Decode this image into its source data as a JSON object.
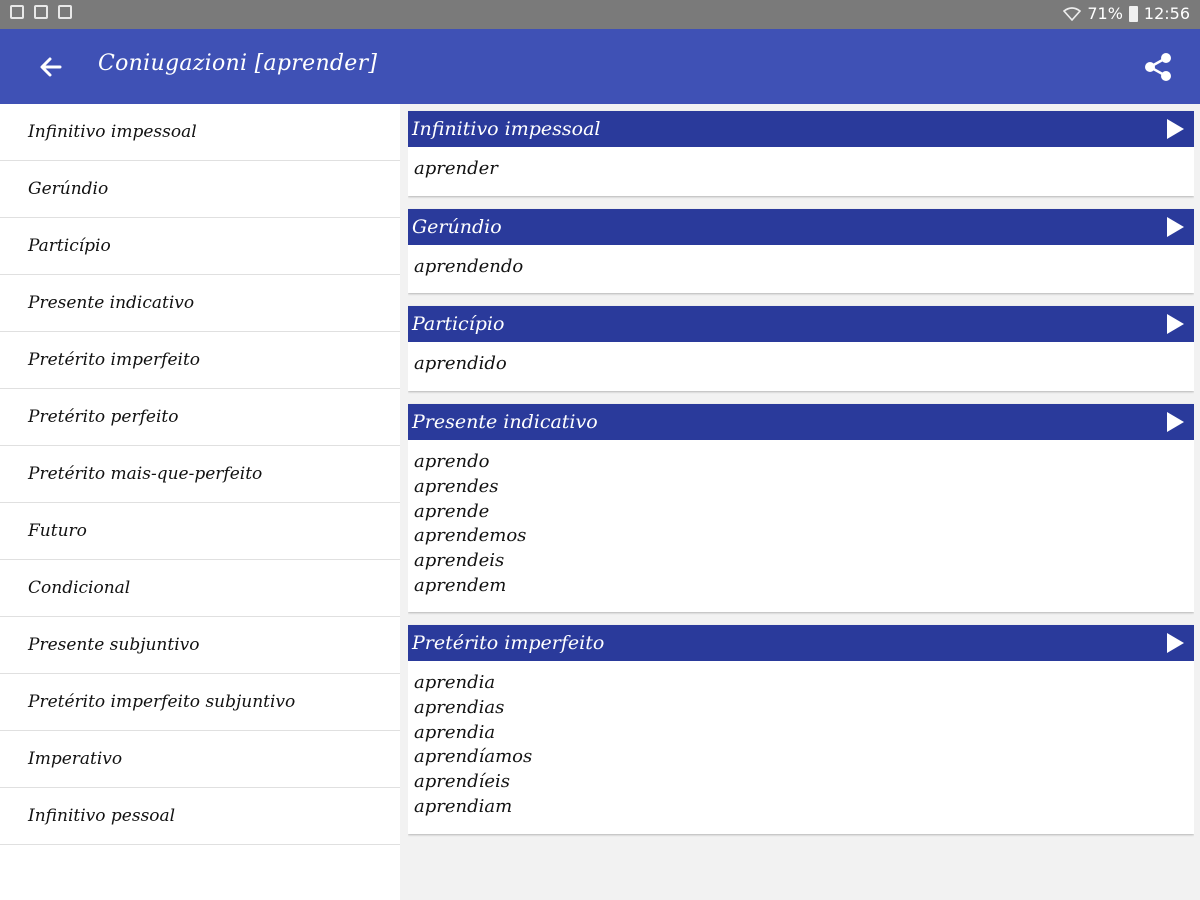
{
  "status": {
    "battery": "71%",
    "time": "12:56"
  },
  "appbar": {
    "title": "Coniugazioni [aprender]"
  },
  "tenses": [
    "Infinitivo impessoal",
    "Gerúndio",
    "Particípio",
    "Presente indicativo",
    "Pretérito imperfeito",
    "Pretérito perfeito",
    "Pretérito mais-que-perfeito",
    "Futuro",
    "Condicional",
    "Presente subjuntivo",
    "Pretérito imperfeito subjuntivo",
    "Imperativo",
    "Infinitivo pessoal"
  ],
  "cards": [
    {
      "title": "Infinitivo impessoal",
      "forms": [
        "aprender"
      ]
    },
    {
      "title": "Gerúndio",
      "forms": [
        "aprendendo"
      ]
    },
    {
      "title": "Particípio",
      "forms": [
        "aprendido"
      ]
    },
    {
      "title": "Presente indicativo",
      "forms": [
        "aprendo",
        "aprendes",
        "aprende",
        "aprendemos",
        "aprendeis",
        "aprendem"
      ]
    },
    {
      "title": "Pretérito imperfeito",
      "forms": [
        "aprendia",
        "aprendias",
        "aprendia",
        "aprendíamos",
        "aprendíeis",
        "aprendiam"
      ]
    }
  ],
  "icons": {
    "back": "arrow-back-icon",
    "share": "share-icon",
    "play": "play-icon"
  },
  "colors": {
    "appbar": "#3f51b5",
    "card_header": "#2a3a9b",
    "status_bar": "#7a7a7a"
  }
}
